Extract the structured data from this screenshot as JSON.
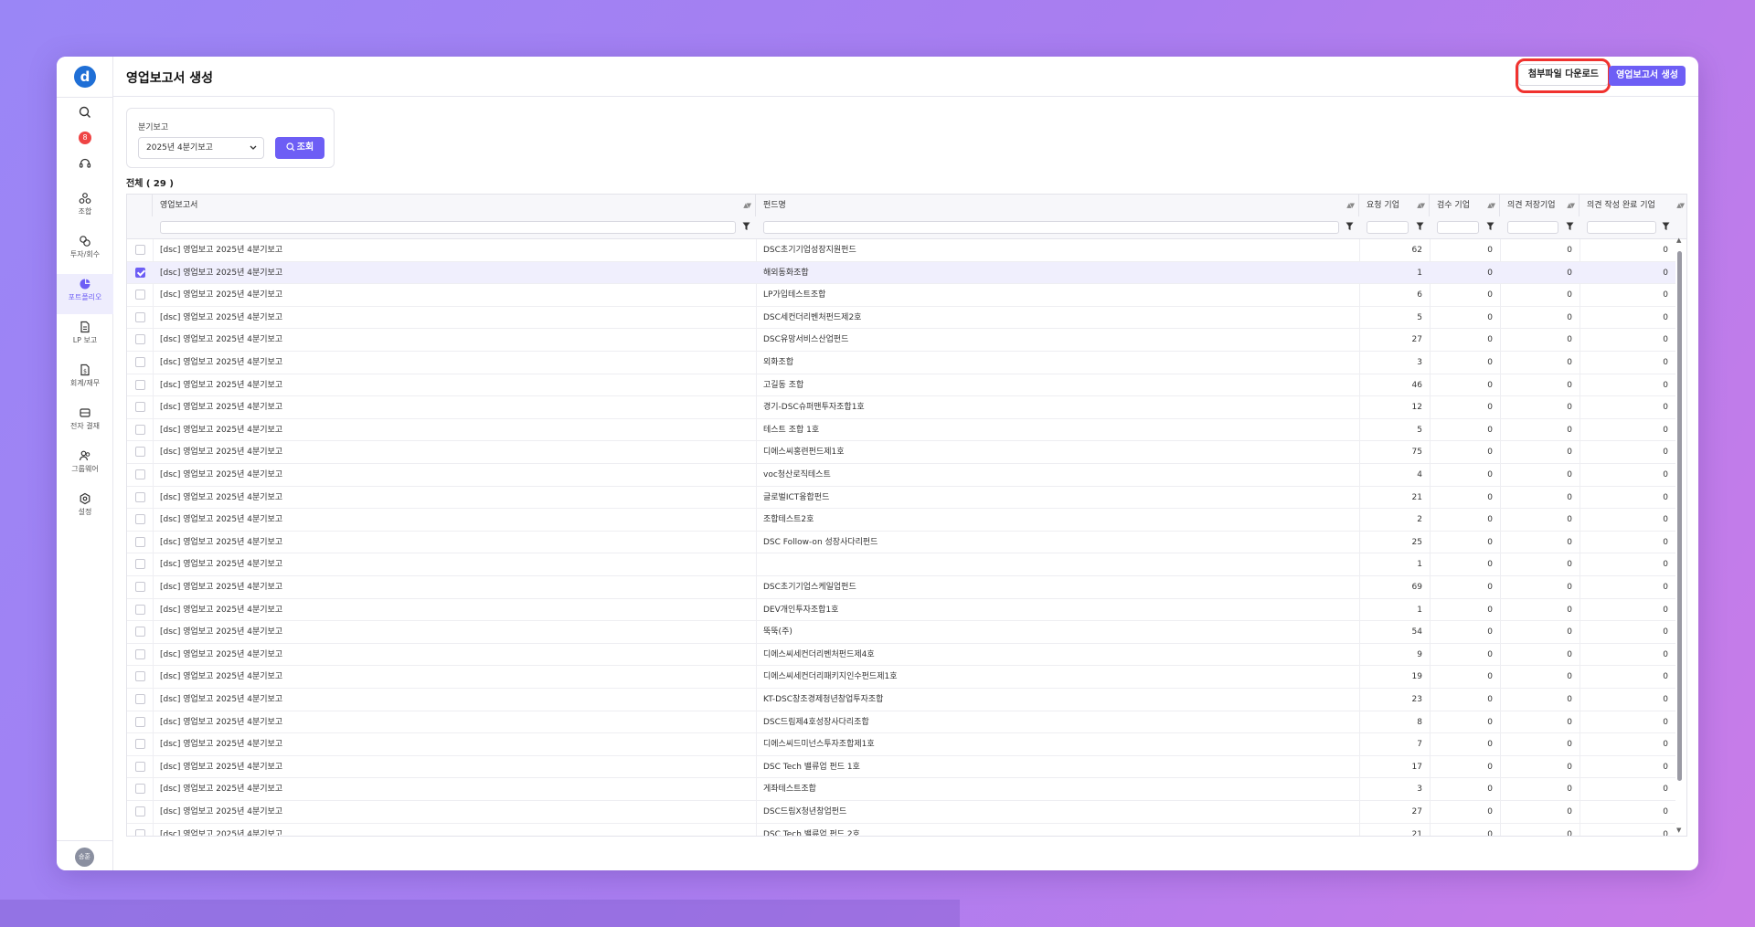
{
  "header": {
    "title": "영업보고서 생성",
    "download_label": "첨부파일 다운로드",
    "create_label": "영업보고서 생성"
  },
  "sidebar": {
    "notification_count": "8",
    "avatar_label": "승훈",
    "items": [
      {
        "label": "조합",
        "icon": "cluster-icon",
        "active": false
      },
      {
        "label": "투자/회수",
        "icon": "investment-icon",
        "active": false
      },
      {
        "label": "포트폴리오",
        "icon": "portfolio-icon",
        "active": true
      },
      {
        "label": "LP 보고",
        "icon": "document-icon",
        "active": false
      },
      {
        "label": "회계/재무",
        "icon": "accounting-icon",
        "active": false
      },
      {
        "label": "전자 결재",
        "icon": "approval-icon",
        "active": false
      },
      {
        "label": "그룹웨어",
        "icon": "users-icon",
        "active": false
      },
      {
        "label": "설정",
        "icon": "gear-icon",
        "active": false
      }
    ]
  },
  "filter": {
    "label": "분기보고",
    "selected": "2025년 4분기보고",
    "search_label": "조회"
  },
  "total": "전체 ( 29 )",
  "table": {
    "columns": [
      "영업보고서",
      "펀드명",
      "요청 기업",
      "검수 기업",
      "의견 저장기업",
      "의견 작성 완료 기업"
    ],
    "rows": [
      {
        "report": "[dsc] 영업보고 2025년 4분기보고",
        "fund": "DSC초기기업성장지원펀드",
        "req": "62",
        "rev": "0",
        "saved": "0",
        "done": "0",
        "checked": false
      },
      {
        "report": "[dsc] 영업보고 2025년 4분기보고",
        "fund": "해외동화조합",
        "req": "1",
        "rev": "0",
        "saved": "0",
        "done": "0",
        "checked": true
      },
      {
        "report": "[dsc] 영업보고 2025년 4분기보고",
        "fund": "LP가입테스트조합",
        "req": "6",
        "rev": "0",
        "saved": "0",
        "done": "0",
        "checked": false
      },
      {
        "report": "[dsc] 영업보고 2025년 4분기보고",
        "fund": "DSC세컨더리벤처펀드제2호",
        "req": "5",
        "rev": "0",
        "saved": "0",
        "done": "0",
        "checked": false
      },
      {
        "report": "[dsc] 영업보고 2025년 4분기보고",
        "fund": "DSC유망서비스산업펀드",
        "req": "27",
        "rev": "0",
        "saved": "0",
        "done": "0",
        "checked": false
      },
      {
        "report": "[dsc] 영업보고 2025년 4분기보고",
        "fund": "외화조합",
        "req": "3",
        "rev": "0",
        "saved": "0",
        "done": "0",
        "checked": false
      },
      {
        "report": "[dsc] 영업보고 2025년 4분기보고",
        "fund": "고길동 조합",
        "req": "46",
        "rev": "0",
        "saved": "0",
        "done": "0",
        "checked": false
      },
      {
        "report": "[dsc] 영업보고 2025년 4분기보고",
        "fund": "경기-DSC슈퍼맨투자조합1호",
        "req": "12",
        "rev": "0",
        "saved": "0",
        "done": "0",
        "checked": false
      },
      {
        "report": "[dsc] 영업보고 2025년 4분기보고",
        "fund": "테스트 조합 1호",
        "req": "5",
        "rev": "0",
        "saved": "0",
        "done": "0",
        "checked": false
      },
      {
        "report": "[dsc] 영업보고 2025년 4분기보고",
        "fund": "디에스씨홍련펀드제1호",
        "req": "75",
        "rev": "0",
        "saved": "0",
        "done": "0",
        "checked": false
      },
      {
        "report": "[dsc] 영업보고 2025년 4분기보고",
        "fund": "voc청산로직테스트",
        "req": "4",
        "rev": "0",
        "saved": "0",
        "done": "0",
        "checked": false
      },
      {
        "report": "[dsc] 영업보고 2025년 4분기보고",
        "fund": "글로벌ICT융합펀드",
        "req": "21",
        "rev": "0",
        "saved": "0",
        "done": "0",
        "checked": false
      },
      {
        "report": "[dsc] 영업보고 2025년 4분기보고",
        "fund": "조합테스트2호",
        "req": "2",
        "rev": "0",
        "saved": "0",
        "done": "0",
        "checked": false
      },
      {
        "report": "[dsc] 영업보고 2025년 4분기보고",
        "fund": "DSC Follow-on 성장사다리펀드",
        "req": "25",
        "rev": "0",
        "saved": "0",
        "done": "0",
        "checked": false
      },
      {
        "report": "[dsc] 영업보고 2025년 4분기보고",
        "fund": "",
        "req": "1",
        "rev": "0",
        "saved": "0",
        "done": "0",
        "checked": false
      },
      {
        "report": "[dsc] 영업보고 2025년 4분기보고",
        "fund": "DSC초기기업스케일업펀드",
        "req": "69",
        "rev": "0",
        "saved": "0",
        "done": "0",
        "checked": false
      },
      {
        "report": "[dsc] 영업보고 2025년 4분기보고",
        "fund": "DEV개인투자조합1호",
        "req": "1",
        "rev": "0",
        "saved": "0",
        "done": "0",
        "checked": false
      },
      {
        "report": "[dsc] 영업보고 2025년 4분기보고",
        "fund": "뚝뚝(주)",
        "req": "54",
        "rev": "0",
        "saved": "0",
        "done": "0",
        "checked": false
      },
      {
        "report": "[dsc] 영업보고 2025년 4분기보고",
        "fund": "디에스씨세컨더리벤처펀드제4호",
        "req": "9",
        "rev": "0",
        "saved": "0",
        "done": "0",
        "checked": false
      },
      {
        "report": "[dsc] 영업보고 2025년 4분기보고",
        "fund": "디에스씨세컨더리패키지인수펀드제1호",
        "req": "19",
        "rev": "0",
        "saved": "0",
        "done": "0",
        "checked": false
      },
      {
        "report": "[dsc] 영업보고 2025년 4분기보고",
        "fund": "KT-DSC창조경제청년창업투자조합",
        "req": "23",
        "rev": "0",
        "saved": "0",
        "done": "0",
        "checked": false
      },
      {
        "report": "[dsc] 영업보고 2025년 4분기보고",
        "fund": "DSC드림제4호성장사다리조합",
        "req": "8",
        "rev": "0",
        "saved": "0",
        "done": "0",
        "checked": false
      },
      {
        "report": "[dsc] 영업보고 2025년 4분기보고",
        "fund": "디에스씨드미넌스투자조합제1호",
        "req": "7",
        "rev": "0",
        "saved": "0",
        "done": "0",
        "checked": false
      },
      {
        "report": "[dsc] 영업보고 2025년 4분기보고",
        "fund": "DSC Tech 밸류업 펀드 1호",
        "req": "17",
        "rev": "0",
        "saved": "0",
        "done": "0",
        "checked": false
      },
      {
        "report": "[dsc] 영업보고 2025년 4분기보고",
        "fund": "게좌테스트조합",
        "req": "3",
        "rev": "0",
        "saved": "0",
        "done": "0",
        "checked": false
      },
      {
        "report": "[dsc] 영업보고 2025년 4분기보고",
        "fund": "DSC드림X청년창업펀드",
        "req": "27",
        "rev": "0",
        "saved": "0",
        "done": "0",
        "checked": false
      },
      {
        "report": "[dsc] 영업보고 2025년 4분기보고",
        "fund": "DSC Tech 밸류업 펀드 2호",
        "req": "21",
        "rev": "0",
        "saved": "0",
        "done": "0",
        "checked": false
      }
    ]
  },
  "colors": {
    "accent": "#6d5ef5",
    "highlight": "#f0322f",
    "badge": "#ef4444"
  }
}
